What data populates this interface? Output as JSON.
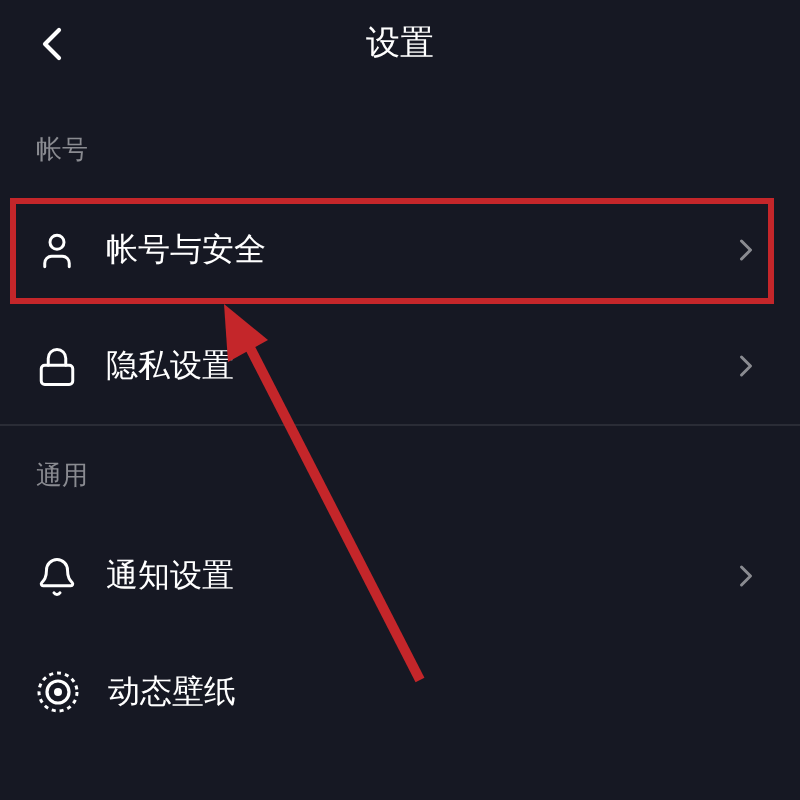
{
  "header": {
    "title": "设置"
  },
  "sections": [
    {
      "label": "帐号",
      "items": [
        {
          "kind": "person",
          "label": "帐号与安全",
          "chevron": true,
          "highlighted": true
        },
        {
          "kind": "lock",
          "label": "隐私设置",
          "chevron": true,
          "highlighted": false
        }
      ]
    },
    {
      "label": "通用",
      "items": [
        {
          "kind": "bell",
          "label": "通知设置",
          "chevron": true,
          "highlighted": false
        },
        {
          "kind": "rings",
          "label": "动态壁纸",
          "chevron": false,
          "highlighted": false
        }
      ]
    }
  ]
}
